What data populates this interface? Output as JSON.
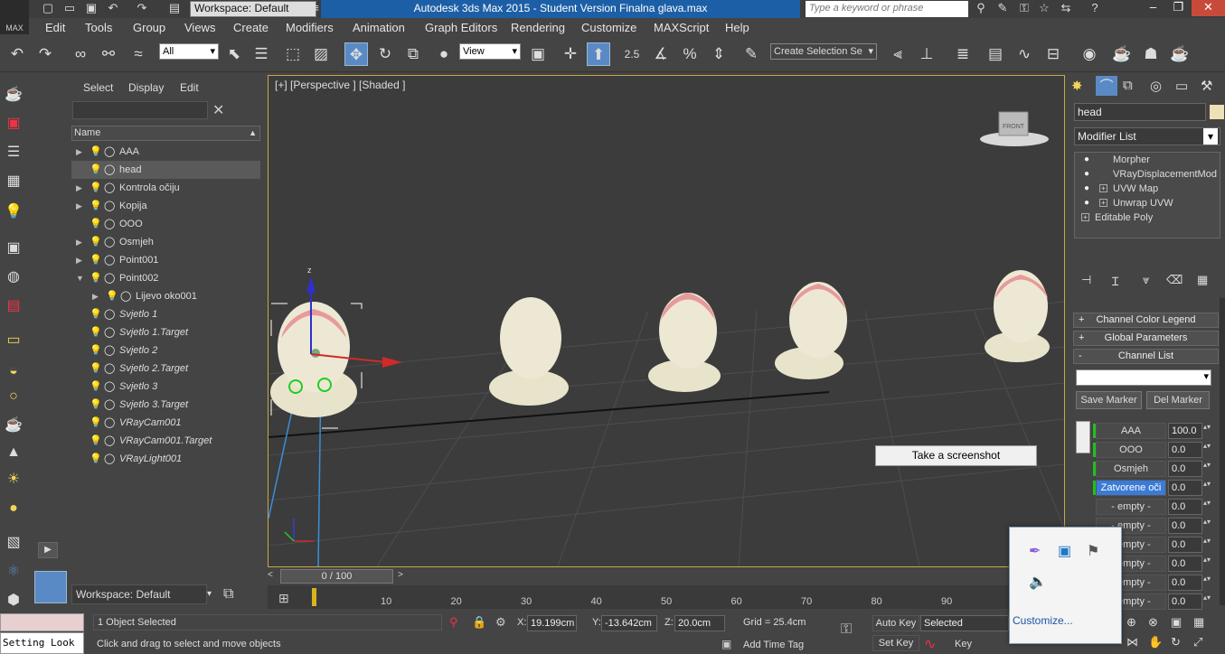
{
  "titlebar": {
    "title": "Autodesk 3ds Max  2015   - Student Version    Finalna glava.max",
    "app_logo": "MAX",
    "workspace": "Workspace: Default",
    "search_placeholder": "Type a keyword or phrase"
  },
  "menu": [
    "Edit",
    "Tools",
    "Group",
    "Views",
    "Create",
    "Modifiers",
    "Animation",
    "Graph Editors",
    "Rendering",
    "Customize",
    "MAXScript",
    "Help"
  ],
  "toolbar": {
    "selection_filter": "All",
    "ref_coord": "View",
    "selection_set": "Create Selection Se",
    "snap_label": "2.5"
  },
  "explorer": {
    "menu": [
      "Select",
      "Display",
      "Edit"
    ],
    "column_header": "Name",
    "rows": [
      {
        "name": "AAA",
        "expand": "▶",
        "on": true,
        "italic": false
      },
      {
        "name": "head",
        "expand": "",
        "on": true,
        "italic": false,
        "selected": true
      },
      {
        "name": "Kontrola očiju",
        "expand": "▶",
        "on": true,
        "italic": false
      },
      {
        "name": "Kopija",
        "expand": "▶",
        "on": true,
        "italic": false
      },
      {
        "name": "OOO",
        "expand": "",
        "on": true,
        "italic": false
      },
      {
        "name": "Osmjeh",
        "expand": "▶",
        "on": true,
        "italic": false
      },
      {
        "name": "Point001",
        "expand": "▶",
        "on": true,
        "italic": false
      },
      {
        "name": "Point002",
        "expand": "▼",
        "on": true,
        "italic": false
      },
      {
        "name": "Lijevo oko001",
        "expand": "▶",
        "on": true,
        "italic": false,
        "indent": true
      },
      {
        "name": "Svjetlo 1",
        "expand": "",
        "on": false,
        "italic": true
      },
      {
        "name": "Svjetlo 1.Target",
        "expand": "",
        "on": false,
        "italic": true
      },
      {
        "name": "Svjetlo 2",
        "expand": "",
        "on": false,
        "italic": true
      },
      {
        "name": "Svjetlo 2.Target",
        "expand": "",
        "on": false,
        "italic": true
      },
      {
        "name": "Svjetlo 3",
        "expand": "",
        "on": false,
        "italic": true
      },
      {
        "name": "Svjetlo 3.Target",
        "expand": "",
        "on": false,
        "italic": true
      },
      {
        "name": "VRayCam001",
        "expand": "",
        "on": false,
        "italic": true
      },
      {
        "name": "VRayCam001.Target",
        "expand": "",
        "on": false,
        "italic": true
      },
      {
        "name": "VRayLight001",
        "expand": "",
        "on": false,
        "italic": true
      }
    ],
    "workspace": "Workspace: Default"
  },
  "viewport": {
    "label": "[+] [Perspective ] [Shaded ]",
    "viewcube_label": "FRONT",
    "screenshot_button": "Take a screenshot"
  },
  "timeline": {
    "slider": "0 / 100",
    "ticks": [
      "10",
      "20",
      "30",
      "40",
      "50",
      "60",
      "70",
      "80",
      "90"
    ]
  },
  "status": {
    "selected": "1 Object Selected",
    "prompt": "Click and drag to select and move objects",
    "x": "19.199cm",
    "y": "-13.642cm",
    "z": "20.0cm",
    "x_label": "X:",
    "y_label": "Y:",
    "z_label": "Z:",
    "grid": "Grid = 25.4cm",
    "auto_key": "Auto Key",
    "set_key": "Set Key",
    "key_mode": "Selected",
    "add_time_tag": "Add Time Tag",
    "key_filters": "Key Filters...",
    "maxscript_text": "Setting Look"
  },
  "command_panel": {
    "object_name": "head",
    "object_color": "#efe1b6",
    "modifier_list": "Modifier List",
    "stack": [
      {
        "name": "Morpher",
        "plus": false,
        "bulb": true
      },
      {
        "name": "VRayDisplacementMod",
        "plus": false,
        "bulb": true
      },
      {
        "name": "UVW Map",
        "plus": true,
        "bulb": true
      },
      {
        "name": "Unwrap UVW",
        "plus": true,
        "bulb": true
      },
      {
        "name": "Editable Poly",
        "plus": true,
        "bulb": false
      }
    ],
    "rollouts": [
      {
        "sign": "+",
        "label": "Channel Color Legend"
      },
      {
        "sign": "+",
        "label": "Global Parameters"
      },
      {
        "sign": "-",
        "label": "Channel List"
      }
    ],
    "save_marker": "Save Marker",
    "del_marker": "Del Marker",
    "channels": [
      {
        "name": "AAA",
        "value": "100.0",
        "green": true
      },
      {
        "name": "OOO",
        "value": "0.0",
        "green": true
      },
      {
        "name": "Osmjeh",
        "value": "0.0",
        "green": true
      },
      {
        "name": "Zatvorene oči",
        "value": "0.0",
        "green": true,
        "selected": true
      },
      {
        "name": "- empty -",
        "value": "0.0",
        "green": false
      },
      {
        "name": "- empty -",
        "value": "0.0",
        "green": false
      },
      {
        "name": "- empty -",
        "value": "0.0",
        "green": false
      },
      {
        "name": "- empty -",
        "value": "0.0",
        "green": false
      },
      {
        "name": "- empty -",
        "value": "0.0",
        "green": false
      },
      {
        "name": "- empty -",
        "value": "0.0",
        "green": false
      }
    ]
  },
  "tray": {
    "customize": "Customize..."
  }
}
